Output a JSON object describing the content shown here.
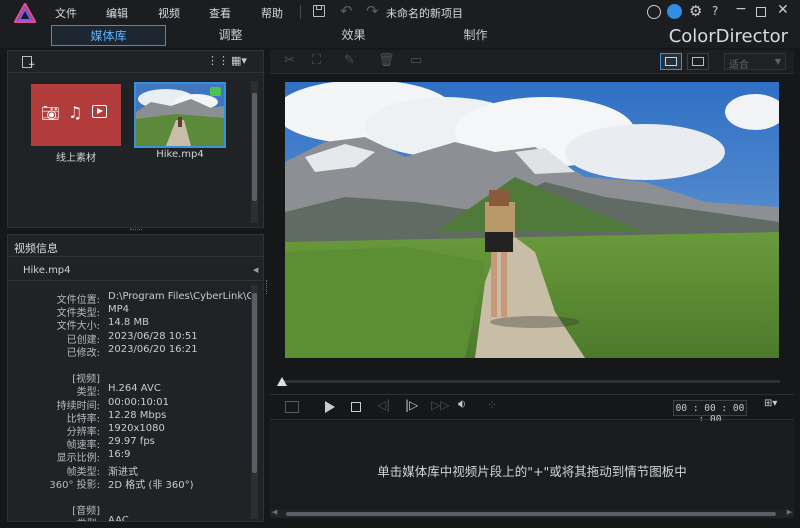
{
  "menu": {
    "file": "文件",
    "edit": "编辑",
    "view": "视频",
    "watch": "查看",
    "help": "帮助",
    "project_title": "未命名的新项目"
  },
  "tabs": [
    {
      "label": "媒体库",
      "active": true
    },
    {
      "label": "调整"
    },
    {
      "label": "效果"
    },
    {
      "label": "制作"
    }
  ],
  "brand": "ColorDirector",
  "media": {
    "items": [
      {
        "label": "线上素材",
        "icon": "online-media-icon",
        "color": "#b23b3b"
      },
      {
        "label": "Hike.mp4",
        "icon": "video-thumbnail"
      }
    ]
  },
  "info": {
    "title": "视频信息",
    "filename": "Hike.mp4",
    "rows": [
      {
        "k": "文件位置:",
        "v": "D:\\Program Files\\CyberLink\\Color..."
      },
      {
        "k": "文件类型:",
        "v": "MP4"
      },
      {
        "k": "文件大小:",
        "v": "14.8 MB"
      },
      {
        "k": "已创建:",
        "v": "2023/06/28 10:51"
      },
      {
        "k": "已修改:",
        "v": "2023/06/20 16:21"
      },
      {
        "k": "",
        "v": ""
      },
      {
        "k": "[视频]",
        "v": ""
      },
      {
        "k": "类型:",
        "v": "H.264 AVC"
      },
      {
        "k": "持续时间:",
        "v": "00:00:10:01"
      },
      {
        "k": "比特率:",
        "v": "12.28 Mbps"
      },
      {
        "k": "分辨率:",
        "v": "1920x1080"
      },
      {
        "k": "帧速率:",
        "v": "29.97 fps"
      },
      {
        "k": "显示比例:",
        "v": "16:9"
      },
      {
        "k": "帧类型:",
        "v": "渐进式"
      },
      {
        "k": "360° 投影:",
        "v": "2D 格式 (非 360°)"
      },
      {
        "k": "",
        "v": ""
      },
      {
        "k": "[音频]",
        "v": ""
      },
      {
        "k": "类型:",
        "v": "AAC"
      }
    ]
  },
  "toolbar": {
    "fit_label": "适合"
  },
  "player": {
    "timecode": "00 : 00 : 00 : 00"
  },
  "hint": "单击媒体库中视频片段上的\"+\"或将其拖动到情节图板中",
  "colors": {
    "accent": "#3a8fd9",
    "online_tile": "#b23b3b"
  }
}
